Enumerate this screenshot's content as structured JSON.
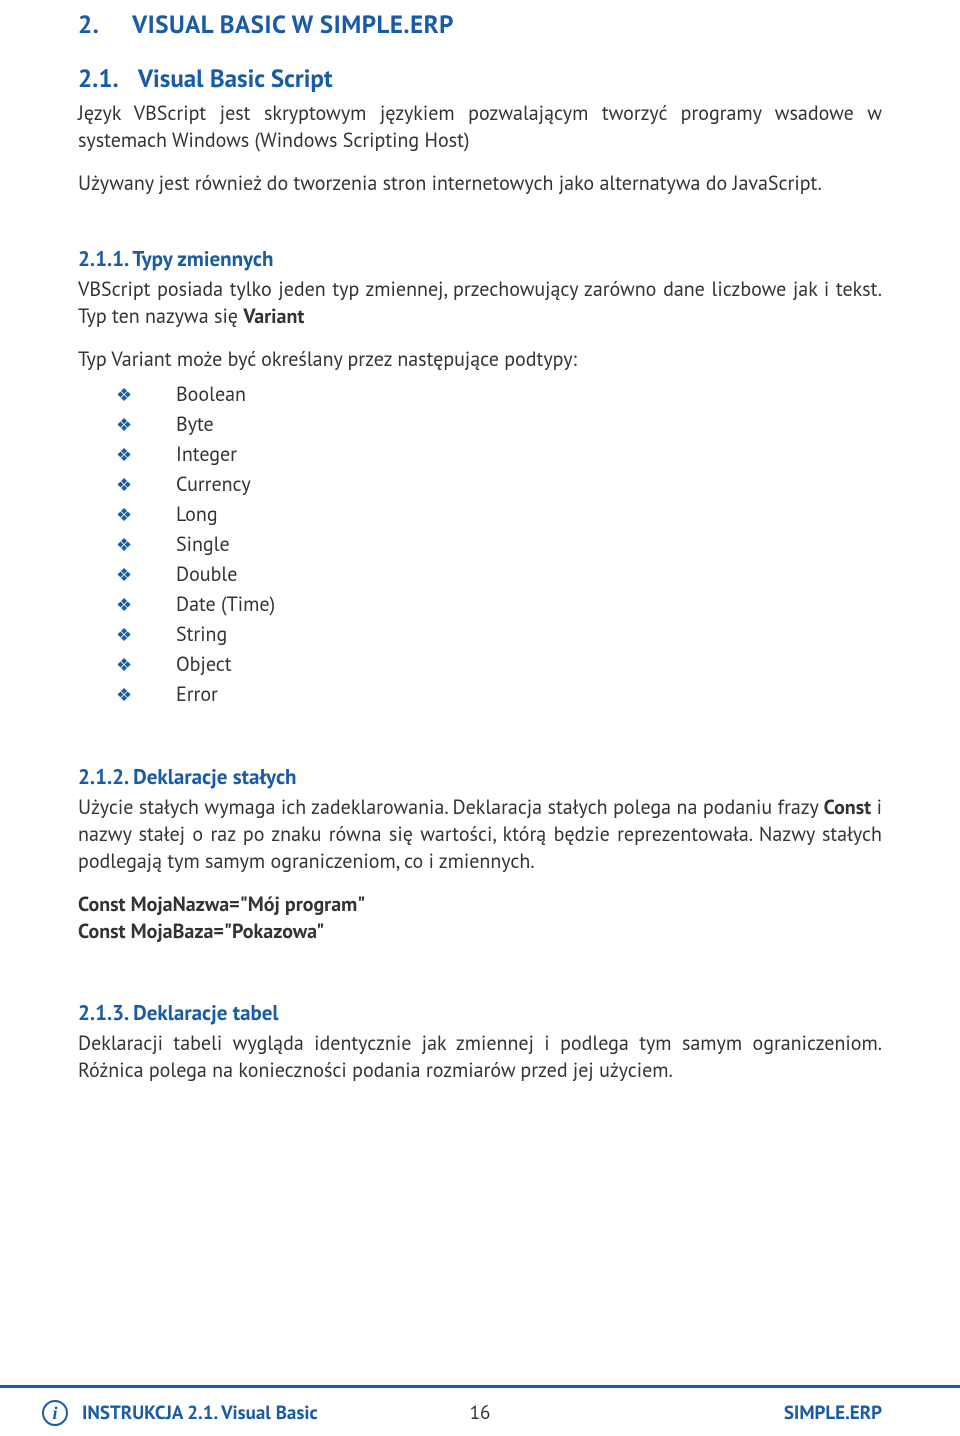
{
  "chapter": {
    "number": "2.",
    "title": "VISUAL BASIC W SIMPLE.ERP"
  },
  "section21": {
    "number": "2.1.",
    "title": "Visual Basic Script",
    "p1": "Język VBScript jest skryptowym językiem pozwalającym tworzyć programy wsadowe w systemach Windows (Windows Scripting Host)",
    "p2": "Używany jest również do tworzenia stron internetowych jako alternatywa do JavaScript."
  },
  "section211": {
    "number": "2.1.1.",
    "title": "Typy zmiennych",
    "p1a": "VBScript posiada tylko jeden typ zmiennej, przechowujący zarówno dane liczbowe jak i tekst. Typ ten nazywa się ",
    "p1b": "Variant",
    "p2": "Typ Variant może być określany przez następujące podtypy:",
    "subtypes": [
      "Boolean",
      "Byte",
      "Integer",
      "Currency",
      "Long",
      "Single",
      "Double",
      "Date (Time)",
      "String",
      "Object",
      "Error"
    ]
  },
  "section212": {
    "number": "2.1.2.",
    "title": "Deklaracje stałych",
    "p1a": "Użycie stałych wymaga ich zadeklarowania. Deklaracja stałych polega na podaniu frazy ",
    "p1b": "Const",
    "p1c": " i nazwy stałej o raz po znaku równa się wartości, którą będzie reprezentowała. Nazwy stałych podlegają tym samym ograniczeniom, co i zmiennych.",
    "code1": "Const MojaNazwa=\"Mój program\"",
    "code2": "Const MojaBaza=\"Pokazowa\""
  },
  "section213": {
    "number": "2.1.3.",
    "title": "Deklaracje tabel",
    "p1": "Deklaracji tabeli wygląda identycznie jak zmiennej i podlega tym samym ograniczeniom. Różnica polega na konieczności podania rozmiarów przed jej użyciem."
  },
  "footer": {
    "left": "INSTRUKCJA 2.1. Visual Basic",
    "center": "16",
    "right": "SIMPLE.ERP",
    "icon_glyph": "i"
  }
}
